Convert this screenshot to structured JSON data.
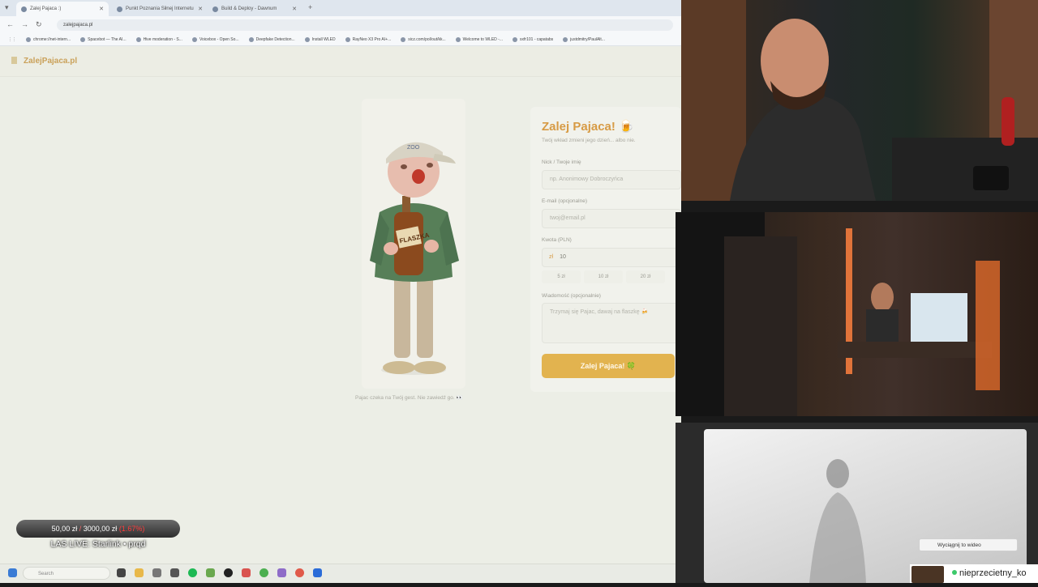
{
  "browser": {
    "tabs": [
      {
        "label": "Zalej Pajaca :)"
      },
      {
        "label": "Punkt Poznania Siłnej Internetu"
      },
      {
        "label": "Build & Deploy - Dawnum"
      }
    ],
    "url": "zalejpajaca.pl",
    "bookmarks": [
      "chrome://net-intern...",
      "Spacebot — The AI...",
      "Hive moderation - S...",
      "Voicebox - Open So...",
      "Deepfake Detection...",
      "Install WLED",
      "RayNeo X3 Pro AI+...",
      "sicz.com/pol/out/kk...",
      "Welcome to WLED -...",
      "sxfr101 - capatabs",
      "justdmitry/PaulAlt..."
    ]
  },
  "site": {
    "logo_text": "ZalejPajaca.pl",
    "caption": "Pajac czeka na Twój gest. Nie zawiedź go. 👀"
  },
  "form": {
    "title": "Zalej Pajaca! 🍺",
    "subtitle": "Twój wkład zmieni jego dzień... albo nie.",
    "nick_label": "Nick / Twoje imię",
    "nick_placeholder": "np. Anonimowy Dobroczyńca",
    "email_label": "E-mail (opcjonalne)",
    "email_placeholder": "twoj@email.pl",
    "amount_label": "Kwota (PLN)",
    "currency": "zł",
    "amount_value": "10",
    "presets": [
      "5 zł",
      "10 zł",
      "20 zł"
    ],
    "message_label": "Wiadomość (opcjonalnie)",
    "message_placeholder": "Trzymaj się Pajac, dawaj na flaszkę 🍻",
    "submit_label": "Zalej Pajaca! 🍀"
  },
  "taskbar": {
    "search_placeholder": "Search"
  },
  "overlay": {
    "raised": "50,00 zł",
    "separator": "/",
    "goal": "3000,00 zł",
    "percent": "(1.67%)",
    "live_label": "LAS LIVE: Starlink • prqd"
  },
  "stream": {
    "tooltip": "Wyciągnij to wideo",
    "username": "nieprzecietny_ko"
  },
  "colors": {
    "accent": "#e2b34f",
    "title": "#d79b45",
    "percent_red": "#ff3b3b"
  }
}
